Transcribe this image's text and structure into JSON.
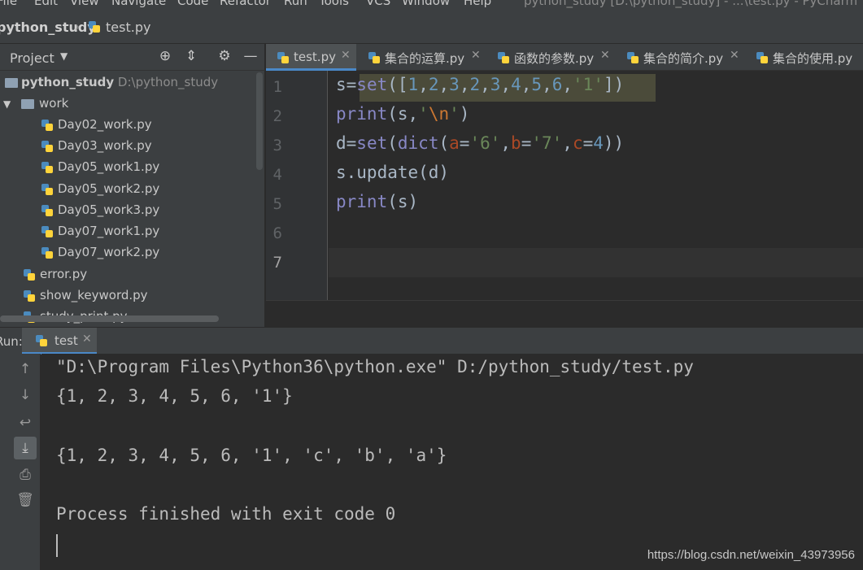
{
  "menubar": {
    "items": [
      "File",
      "Edit",
      "View",
      "Navigate",
      "Code",
      "Refactor",
      "Run",
      "Tools",
      "VCS",
      "Window",
      "Help"
    ],
    "title": "python_study [D:\\python_study] - ...\\test.py - PyCharm"
  },
  "navbar": {
    "root": "python_study",
    "file": "test.py"
  },
  "project": {
    "label": "Project",
    "tree": [
      {
        "name": "python_study",
        "path": "D:\\python_study"
      },
      {
        "name": "work"
      },
      {
        "name": "Day02_work.py"
      },
      {
        "name": "Day03_work.py"
      },
      {
        "name": "Day05_work1.py"
      },
      {
        "name": "Day05_work2.py"
      },
      {
        "name": "Day05_work3.py"
      },
      {
        "name": "Day07_work1.py"
      },
      {
        "name": "Day07_work2.py"
      },
      {
        "name": "error.py"
      },
      {
        "name": "show_keyword.py"
      },
      {
        "name": "study_print.py"
      }
    ]
  },
  "editor": {
    "tabs": [
      "test.py",
      "集合的运算.py",
      "函数的参数.py",
      "集合的简介.py",
      "集合的使用.py"
    ],
    "line_numbers": [
      "1",
      "2",
      "3",
      "4",
      "5",
      "6",
      "7"
    ]
  },
  "run": {
    "label": "Run:",
    "tab": "test",
    "output": [
      "\"D:\\Program Files\\Python36\\python.exe\" D:/python_study/test.py",
      "{1, 2, 3, 4, 5, 6, '1'}",
      "",
      "{1, 2, 3, 4, 5, 6, '1', 'c', 'b', 'a'}",
      "",
      "Process finished with exit code 0"
    ]
  },
  "watermark": "https://blog.csdn.net/weixin_43973956",
  "colors": {
    "background": "#2b2b2b",
    "panel": "#3c3f41",
    "accent": "#4a88c7",
    "keyword": "#8888c6",
    "string": "#6a8759",
    "number": "#6897bb"
  }
}
